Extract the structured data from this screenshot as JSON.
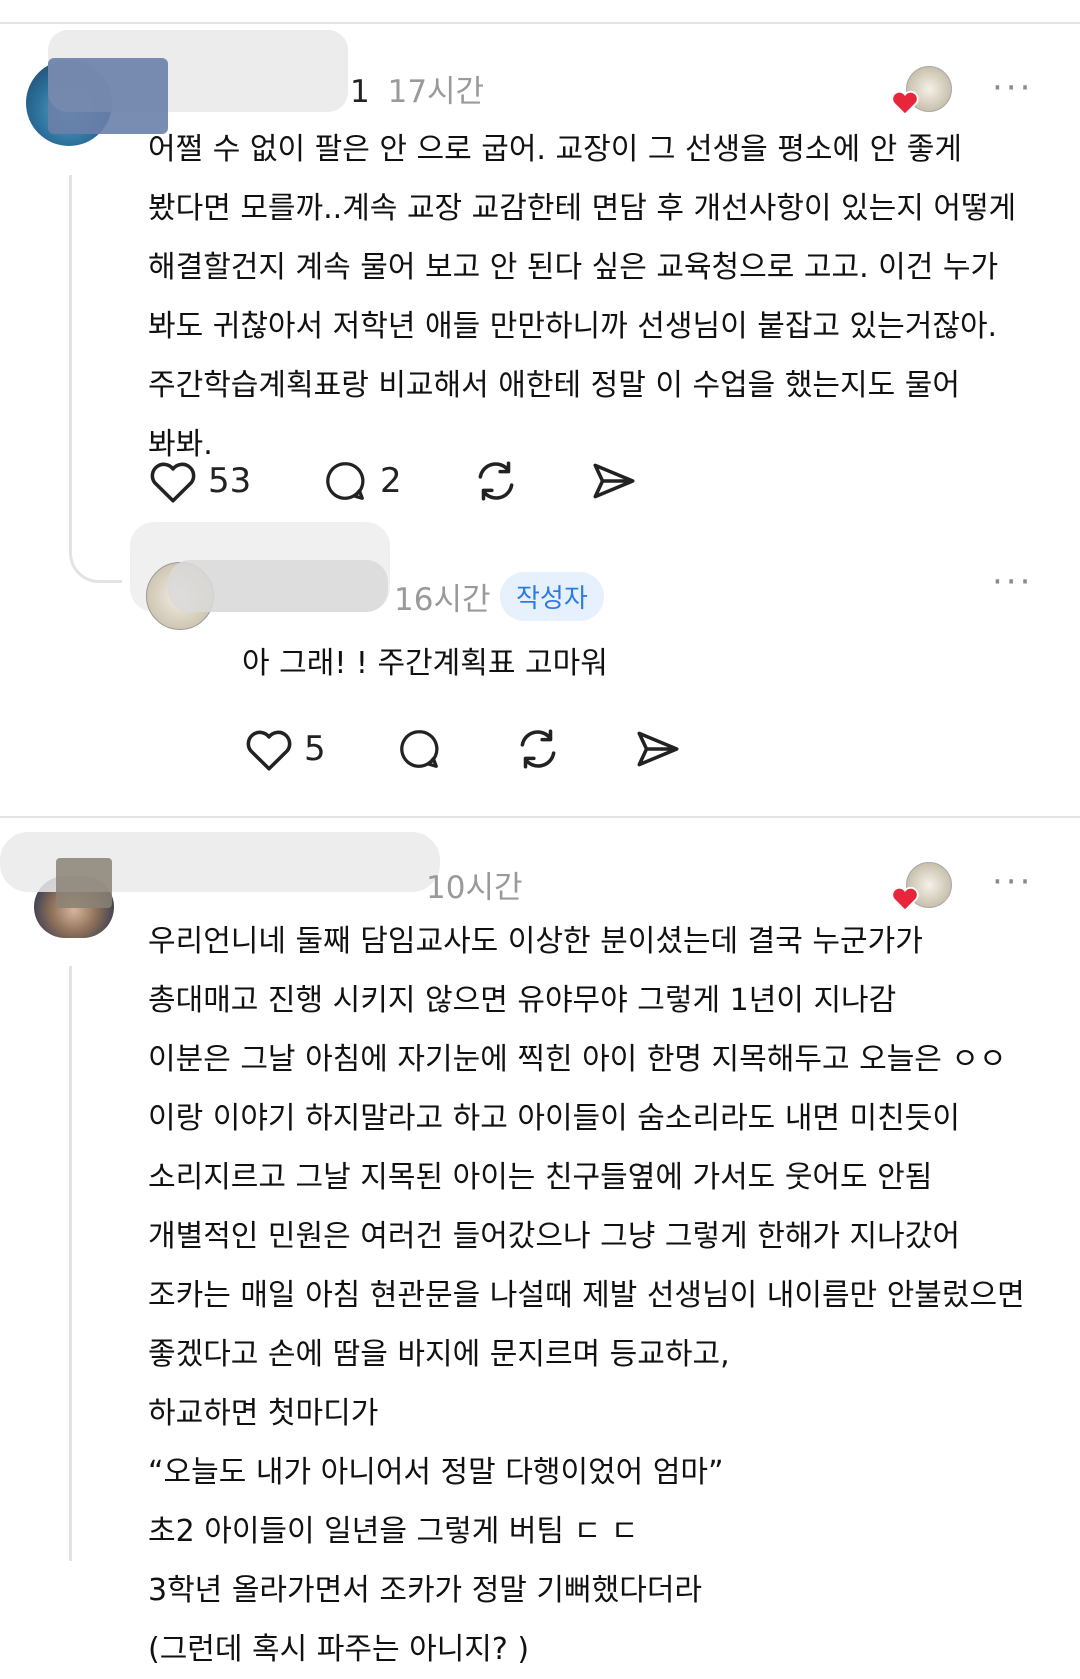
{
  "comments": [
    {
      "author_tail": "1",
      "time": "17시간",
      "more": "···",
      "lines": [
        "어쩔 수 없이 팔은 안 으로 굽어. 교장이 그 선생을 평소에 안 좋게",
        "봤다면 모를까..계속 교장 교감한테 면담 후 개선사항이 있는지 어떻게",
        "해결할건지 계속 물어 보고 안 된다 싶은 교육청으로 고고. 이건 누가",
        "봐도 귀찮아서 저학년 애들 만만하니까 선생님이 붙잡고 있는거잖아.",
        "주간학습계획표랑 비교해서 애한테 정말 이 수업을 했는지도 물어",
        "봐봐."
      ],
      "actions": {
        "likes": "53",
        "replies": "2"
      }
    },
    {
      "time": "16시간",
      "badge": "작성자",
      "more": "···",
      "lines": [
        "아 그래! ! 주간계획표 고마워"
      ],
      "actions": {
        "likes": "5"
      }
    },
    {
      "author_tail": "10시간",
      "more": "···",
      "lines": [
        "우리언니네 둘째 담임교사도 이상한 분이셨는데 결국 누군가가",
        "총대매고 진행 시키지 않으면 유야무야 그렇게 1년이 지나감",
        "이분은 그날 아침에 자기눈에 찍힌 아이 한명 지목해두고 오늘은 ㅇㅇ",
        "이랑 이야기 하지말라고 하고 아이들이 숨소리라도 내면 미친듯이",
        "소리지르고 그날 지목된 아이는 친구들옆에 가서도 웃어도 안됨",
        "개별적인 민원은 여러건 들어갔으나 그냥 그렇게 한해가 지나갔어",
        "조카는 매일 아침 현관문을 나설때 제발 선생님이 내이름만 안불렀으면",
        "좋겠다고 손에 땀을 바지에 문지르며 등교하고,",
        "하교하면 첫마디가",
        "“오늘도 내가 아니어서 정말 다행이었어 엄마”",
        "초2 아이들이 일년을 그렇게 버팀 ㄷ ㄷ",
        "3학년 올라가면서 조카가 정말 기뻐했다더라",
        "(그런데 혹시 파주는 아니지? )"
      ]
    }
  ],
  "colors": {
    "heart_badge": "#e8263b",
    "verified_badge_bg": "#e6f1fd",
    "verified_badge_text": "#2c7be5",
    "meta_gray": "#9a9a9a"
  },
  "icons": [
    "heart-icon",
    "comment-icon",
    "repost-icon",
    "send-icon",
    "more-icon",
    "liked-heart-icon"
  ]
}
